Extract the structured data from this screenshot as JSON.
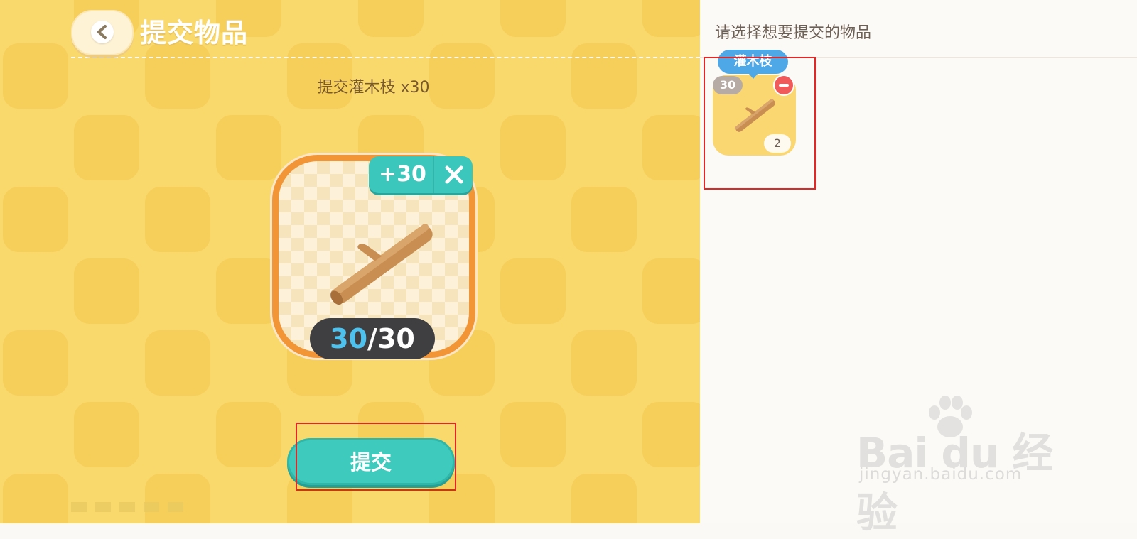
{
  "header": {
    "title": "提交物品"
  },
  "request": {
    "text": "提交灌木枝 x30"
  },
  "item_card": {
    "icon": "branch-icon",
    "add_badge": "+30",
    "close_icon": "close-icon",
    "count_current": "30",
    "count_separator": "/",
    "count_total": "30"
  },
  "submit": {
    "label": "提交"
  },
  "right_panel": {
    "title": "请选择想要提交的物品",
    "items": [
      {
        "name": "灌木枝",
        "selected_qty": "30",
        "slot_number": "2",
        "icon": "branch-icon"
      }
    ]
  },
  "watermark": {
    "brand": "Bai du 经验",
    "url": "jingyan.baidu.com"
  },
  "colors": {
    "accent_teal": "#3cc7bd",
    "card_border": "#f19536",
    "panel_bg": "#f9d96c",
    "highlight_box": "#e22525",
    "tooltip_blue": "#4ea8e8",
    "remove_red": "#f05a5a"
  }
}
